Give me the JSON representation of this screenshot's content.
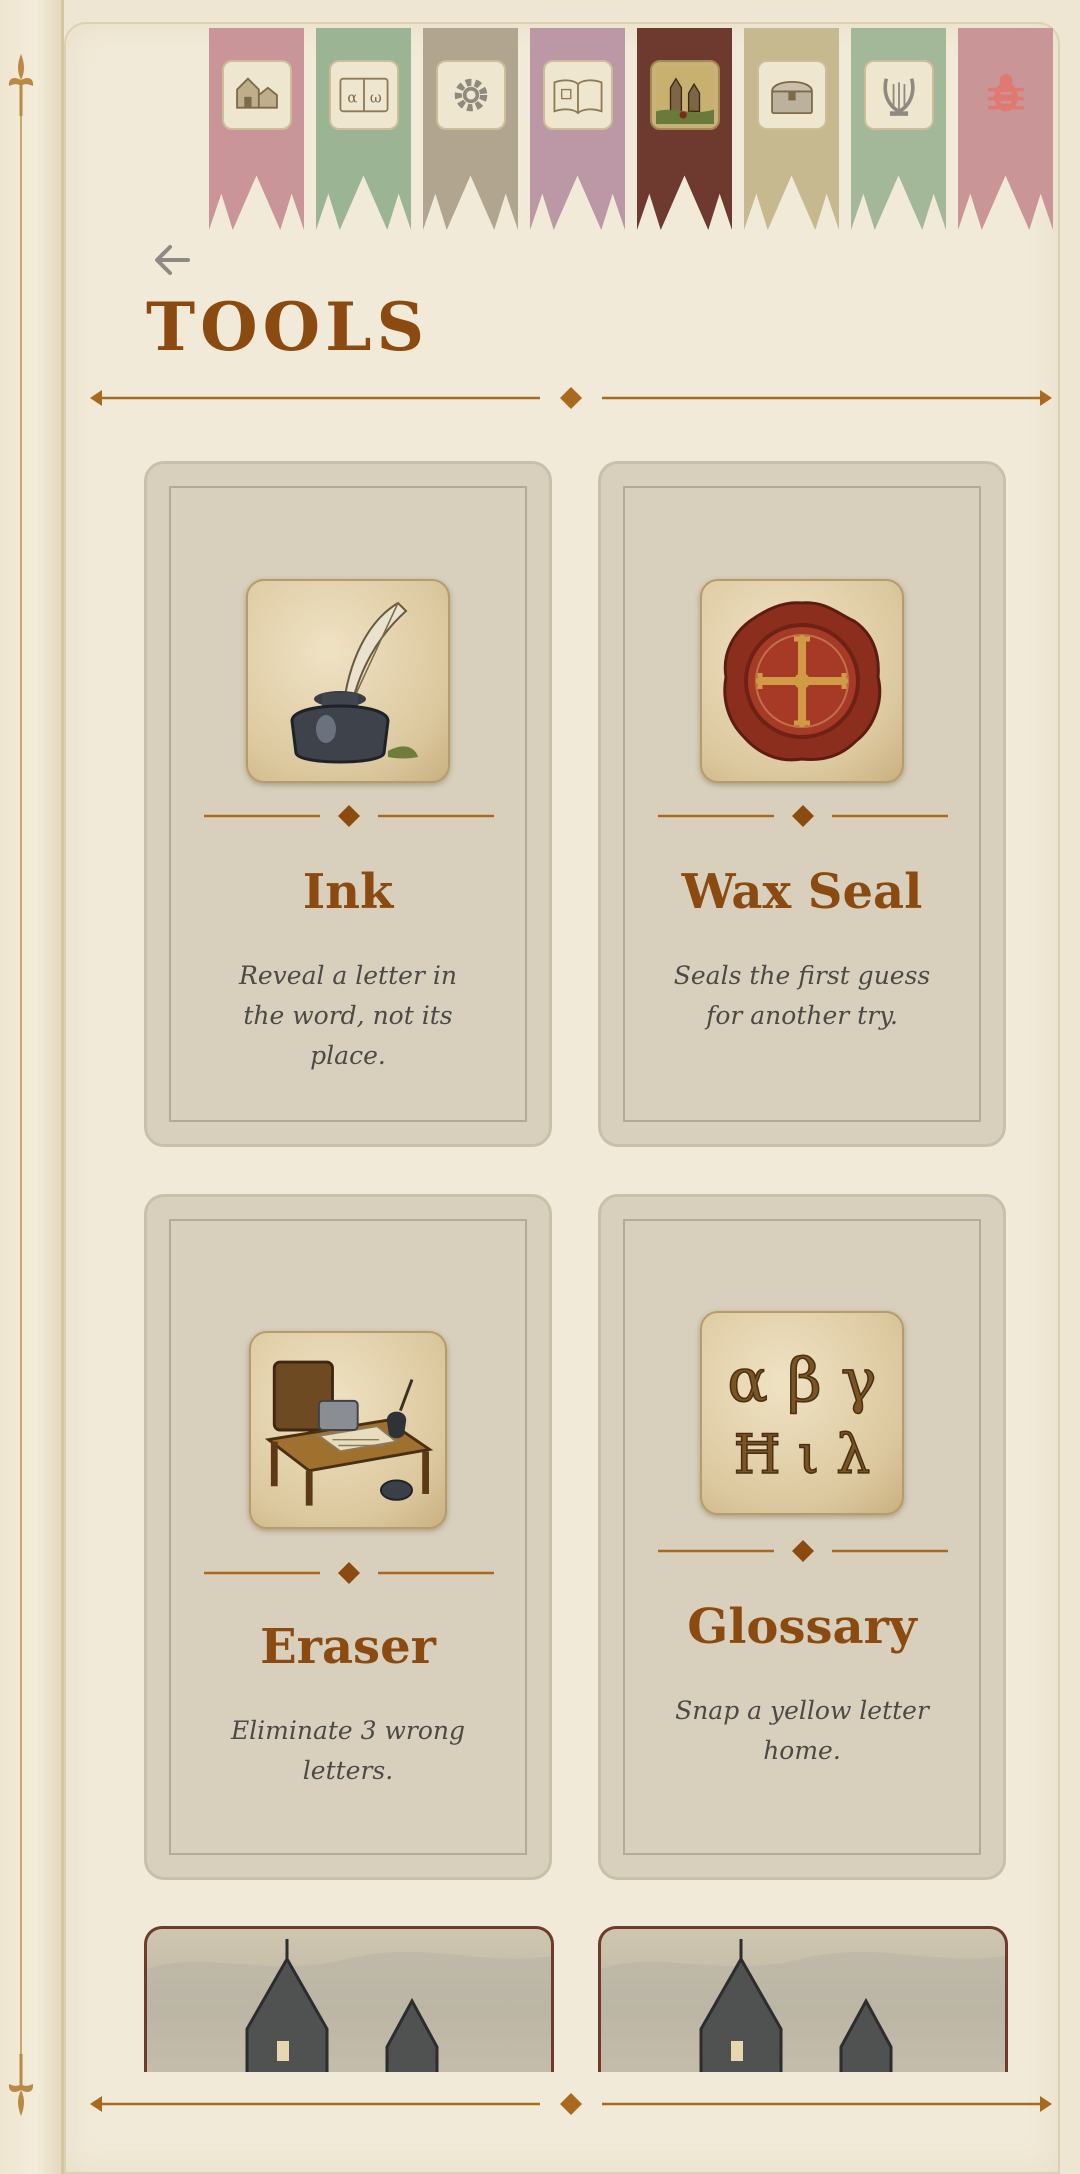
{
  "screen": {
    "title": "TOOLS"
  },
  "nav": {
    "back_label": "back",
    "banners": [
      {
        "name": "village",
        "color": "#c99598",
        "active": false
      },
      {
        "name": "alphabet-book",
        "color": "#9bb594",
        "active": false
      },
      {
        "name": "settings",
        "color": "#b2a58f",
        "active": false
      },
      {
        "name": "open-book",
        "color": "#bc97a6",
        "active": false
      },
      {
        "name": "castle-scene",
        "color": "#6e3a2f",
        "active": true
      },
      {
        "name": "treasure-chest",
        "color": "#c6b88f",
        "active": false
      },
      {
        "name": "lyre",
        "color": "#a3b898",
        "active": false
      },
      {
        "name": "bug",
        "color": "#c99596",
        "active": false
      }
    ]
  },
  "tools": [
    {
      "title": "Ink",
      "description": "Reveal a letter in the word, not its place.",
      "icon": "inkwell-quill-icon"
    },
    {
      "title": "Wax Seal",
      "description": "Seals the first guess for another try.",
      "icon": "wax-seal-icon"
    },
    {
      "title": "Eraser",
      "description": "Eliminate 3 wrong letters.",
      "icon": "writing-desk-icon"
    },
    {
      "title": "Glossary",
      "description": "Snap a yellow letter home.",
      "icon": "greek-letters-icon"
    }
  ],
  "glossary_glyphs": {
    "row1": "α β γ",
    "row2": "Ħ ι λ"
  },
  "colors": {
    "accent": "#8b4a0f",
    "background": "#eee6d2",
    "card": "#d8d0bd",
    "divider": "#a9691f"
  }
}
